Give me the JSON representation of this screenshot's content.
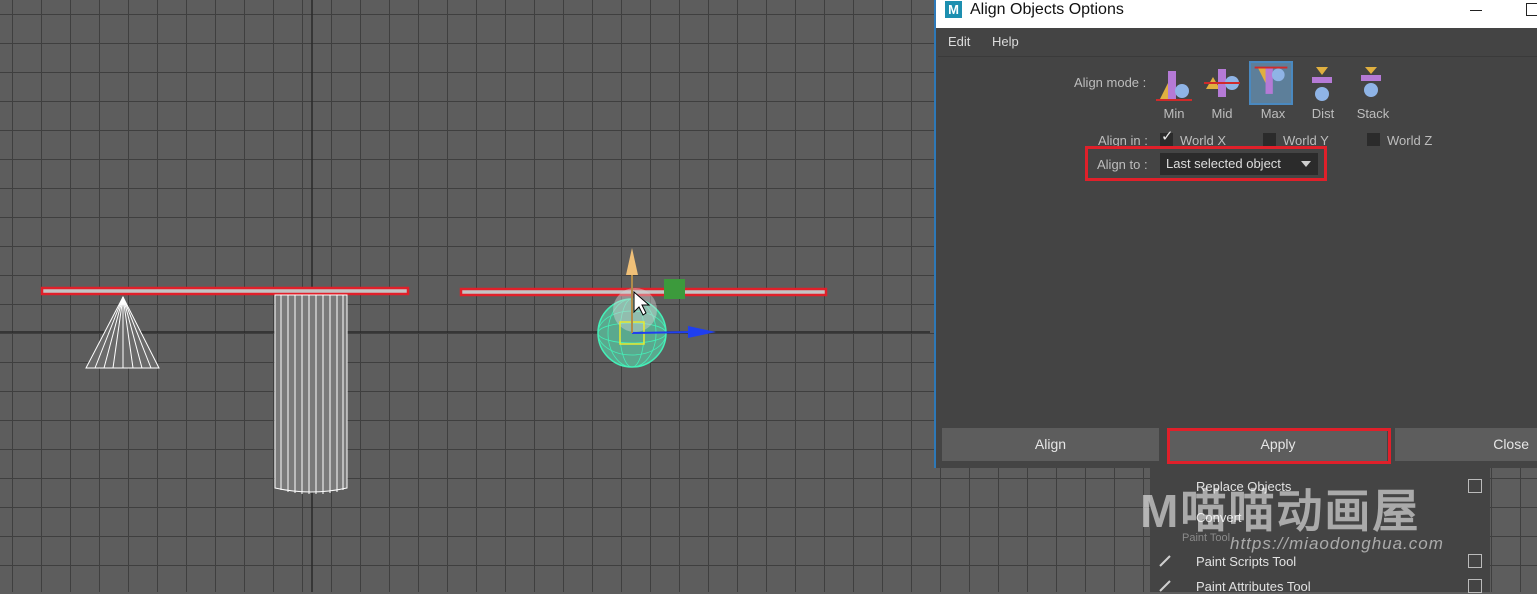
{
  "window": {
    "title": "Align Objects Options",
    "logo_letter": "M"
  },
  "menubar": [
    "Edit",
    "Help"
  ],
  "align_mode": {
    "label": "Align mode :",
    "modes": [
      "Min",
      "Mid",
      "Max",
      "Dist",
      "Stack"
    ],
    "selected": "Max"
  },
  "align_in": {
    "label": "Align in :",
    "options": [
      {
        "label": "World X",
        "checked": true
      },
      {
        "label": "World Y",
        "checked": false
      },
      {
        "label": "World Z",
        "checked": false
      }
    ]
  },
  "align_to": {
    "label": "Align to :",
    "value": "Last selected object"
  },
  "footer_buttons": [
    "Align",
    "Apply",
    "Close"
  ],
  "background_menu": {
    "items": [
      "Replace Objects",
      "Convert",
      "Paint Scripts Tool",
      "Paint Attributes Tool"
    ],
    "section_label": "Paint Tool"
  },
  "watermark": {
    "text": "M喵喵动画屋",
    "url": "https://miaodonghua.com"
  },
  "colors": {
    "highlight": "#e0202a",
    "selected_mode": "#5d7f9a",
    "viewport": "#5d5d5d",
    "dialog_bg": "#444444"
  }
}
